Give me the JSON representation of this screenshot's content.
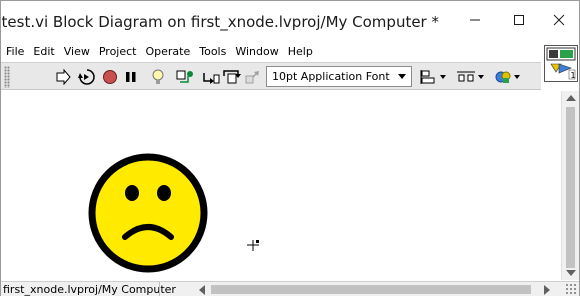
{
  "window": {
    "title": "test.vi Block Diagram on first_xnode.lvproj/My Computer *",
    "controls": {
      "minimize": "minimize",
      "maximize": "maximize",
      "close": "close"
    }
  },
  "menubar": {
    "items": [
      "File",
      "Edit",
      "View",
      "Project",
      "Operate",
      "Tools",
      "Window",
      "Help"
    ]
  },
  "toolbar": {
    "font_select": {
      "value": "10pt Application Font"
    },
    "icons": [
      "run-arrow",
      "run-continuously",
      "abort",
      "pause",
      "highlight-execution-bulb",
      "retain-wire-values",
      "step-into",
      "step-over",
      "step-out",
      "text-settings",
      "align-objects",
      "distribute-objects",
      "reorder"
    ]
  },
  "vi_icon": {
    "number": "1"
  },
  "canvas": {
    "object": "frown-face-icon",
    "colors": {
      "face": "#ffea00",
      "outline": "#000000"
    }
  },
  "statusbar": {
    "path": "first_xnode.lvproj/My Computer"
  }
}
